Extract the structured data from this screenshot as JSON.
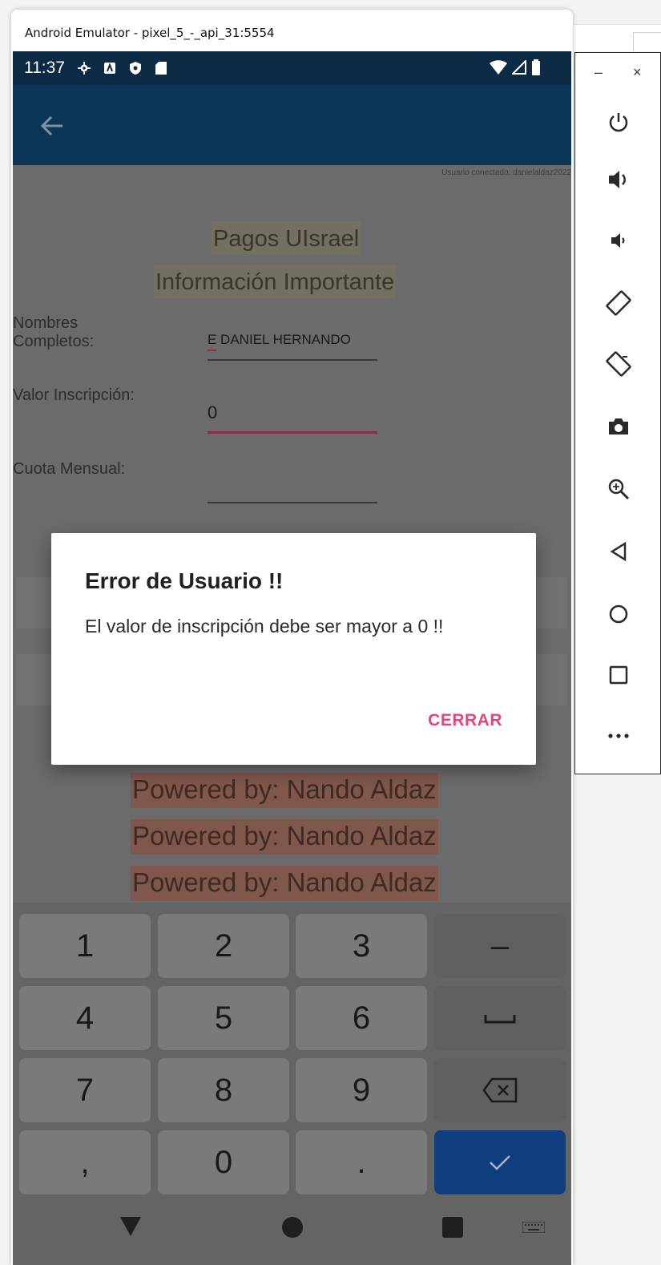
{
  "window": {
    "title": "Android Emulator - pixel_5_-_api_31:5554"
  },
  "status_bar": {
    "time": "11:37"
  },
  "app": {
    "user_connected": "Usuario conectado: danielaldaz2022",
    "title": "Pagos UIsrael",
    "subtitle": "Información Importante",
    "fields": {
      "nombres_label": "Nombres\nCompletos:",
      "nombres_value": "E DANIEL HERNANDO",
      "inscripcion_label": "Valor Inscripción:",
      "inscripcion_value": "0",
      "cuota_label": "Cuota Mensual:",
      "cuota_value": ""
    },
    "powered": [
      "Powered by: Nando Aldaz",
      "Powered by: Nando Aldaz",
      "Powered by: Nando Aldaz"
    ]
  },
  "dialog": {
    "title": "Error de Usuario !!",
    "message": "El valor de inscripción debe ser mayor a 0 !!",
    "button": "CERRAR"
  },
  "keyboard": {
    "rows": [
      [
        "1",
        "2",
        "3",
        "–"
      ],
      [
        "4",
        "5",
        "6",
        "space"
      ],
      [
        "7",
        "8",
        "9",
        "backspace"
      ],
      [
        ",",
        "0",
        ".",
        "enter"
      ]
    ]
  },
  "side_panel": {
    "controls": [
      "power",
      "volume-up",
      "volume-down",
      "rotate-left",
      "rotate-right",
      "screenshot",
      "zoom",
      "back",
      "home",
      "overview",
      "more"
    ]
  },
  "colors": {
    "status_bar": "#0d2a45",
    "app_bar": "#0b3658",
    "dialog_accent": "#e8437d",
    "input_error_line": "#b0335c",
    "enter_key": "#0e3e80"
  }
}
